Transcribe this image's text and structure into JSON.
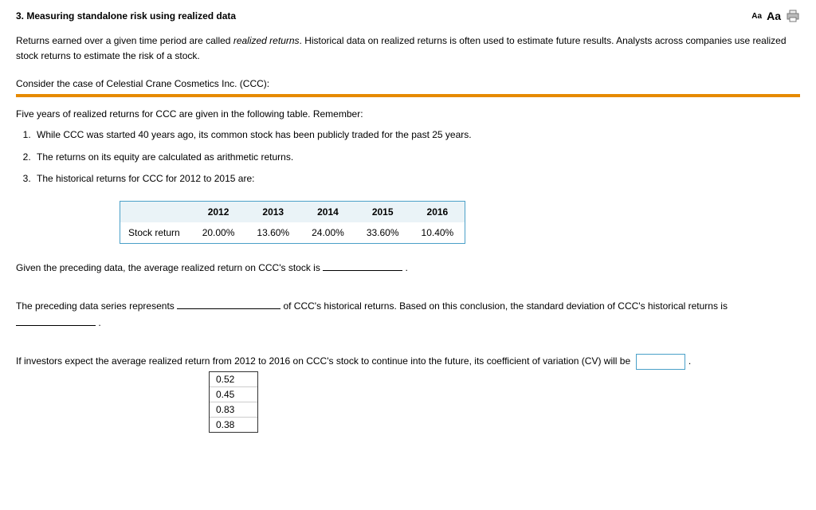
{
  "header": {
    "title": "3.  Measuring standalone risk using realized data",
    "font_small": "Aa",
    "font_large": "Aa"
  },
  "intro_html": "Returns earned over a given time period are called <em>realized returns</em>. Historical data on realized returns is often used to estimate future results. Analysts across companies use realized stock returns to estimate the risk of a stock.",
  "case_line": "Consider the case of Celestial Crane Cosmetics Inc. (CCC):",
  "remember_line": "Five years of realized returns for CCC are given in the following table. Remember:",
  "points": [
    "While CCC was started 40 years ago, its common stock has been publicly traded for the past 25 years.",
    "The returns on its equity are calculated as arithmetic returns.",
    "The historical returns for CCC for 2012 to 2015 are:"
  ],
  "chart_data": {
    "type": "table",
    "row_label": "Stock return",
    "categories": [
      "2012",
      "2013",
      "2014",
      "2015",
      "2016"
    ],
    "values": [
      "20.00%",
      "13.60%",
      "24.00%",
      "33.60%",
      "10.40%"
    ]
  },
  "q1_prefix": "Given the preceding data, the average realized return on CCC's stock is ",
  "q1_suffix": " .",
  "q2_part1": "The preceding data series represents ",
  "q2_mid": " of CCC's historical returns. Based on this conclusion, the standard deviation of CCC's historical returns is ",
  "q2_suffix": " .",
  "q3_prefix": "If investors expect the average realized return from 2012 to 2016 on CCC's stock to continue into the future, its coefficient of variation (CV) will be",
  "q3_suffix": " .",
  "cv_options": [
    "0.52",
    "0.45",
    "0.83",
    "0.38"
  ]
}
